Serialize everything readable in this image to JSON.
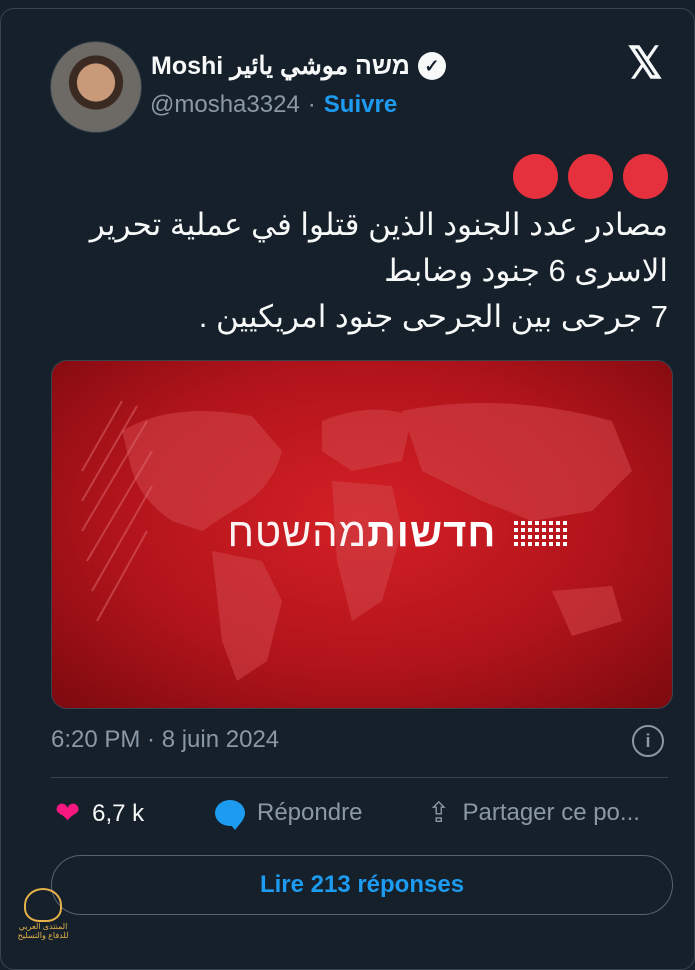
{
  "user": {
    "display_name": "Moshi משה موشي يائير",
    "handle": "@mosha3324",
    "follow_label": "Suivre"
  },
  "tweet": {
    "emoji": [
      "red-circle",
      "red-circle",
      "red-circle"
    ],
    "lines": [
      "مصادر عدد الجنود الذين قتلوا في عملية تحرير",
      "الاسرى 6 جنود وضابط",
      "7 جرحى بين الجرحى جنود امريكيين ."
    ],
    "timestamp": "6:20 PM · 8 juin 2024"
  },
  "media": {
    "logo_bold": "חדשות",
    "logo_light": "מהשטח"
  },
  "actions": {
    "likes": "6,7 k",
    "reply_label": "Répondre",
    "share_label": "Partager ce po..."
  },
  "read_button": "Lire 213 réponses",
  "watermark": "المنتدى العربي للدفاع والتسليح",
  "colors": {
    "accent": "#1d9bf0",
    "background": "#15202b",
    "emoji_red": "#e5313d",
    "like": "#f91880"
  }
}
